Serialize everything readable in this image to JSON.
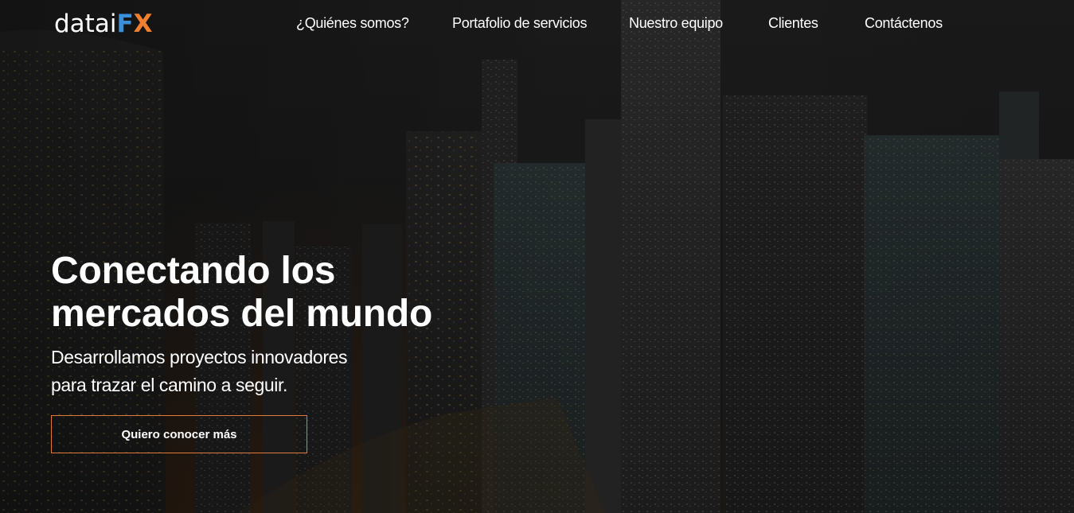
{
  "brand": {
    "logo_word": "datai",
    "logo_fx_f": "F",
    "logo_fx_x": "X",
    "colors": {
      "fx_blue": "#3b8fd9",
      "fx_orange": "#f07f2f"
    }
  },
  "nav": {
    "items": [
      {
        "label": "¿Quiénes somos?"
      },
      {
        "label": "Portafolio de servicios"
      },
      {
        "label": "Nuestro equipo"
      },
      {
        "label": "Clientes"
      },
      {
        "label": "Contáctenos"
      }
    ]
  },
  "hero": {
    "title_line1": "Conectando los",
    "title_line2": "mercados del mundo",
    "subtitle_line1": "Desarrollamos proyectos innovadores",
    "subtitle_line2": "para trazar el camino a seguir.",
    "cta_label": "Quiero conocer más",
    "cta_border_color": "#e07b3c",
    "background_image": "night-city-skyline"
  }
}
